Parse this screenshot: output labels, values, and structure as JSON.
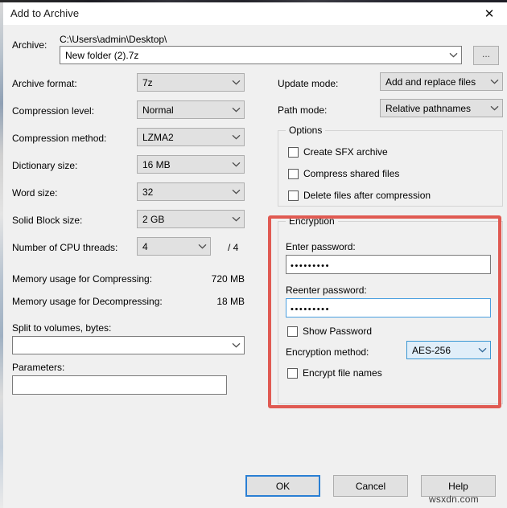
{
  "window": {
    "title": "Add to Archive",
    "close_icon": "close-icon"
  },
  "archive": {
    "label": "Archive:",
    "path": "C:\\Users\\admin\\Desktop\\",
    "value": "New folder (2).7z",
    "browse_label": "..."
  },
  "left_fields": [
    {
      "label": "Archive format:",
      "value": "7z"
    },
    {
      "label": "Compression level:",
      "value": "Normal"
    },
    {
      "label": "Compression method:",
      "value": "LZMA2"
    },
    {
      "label": "Dictionary size:",
      "value": "16 MB"
    },
    {
      "label": "Word size:",
      "value": "32"
    },
    {
      "label": "Solid Block size:",
      "value": "2 GB"
    },
    {
      "label": "Number of CPU threads:",
      "value": "4",
      "suffix": "/ 4"
    }
  ],
  "memory": {
    "compress_label": "Memory usage for Compressing:",
    "compress_value": "720 MB",
    "decompress_label": "Memory usage for Decompressing:",
    "decompress_value": "18 MB"
  },
  "split": {
    "label": "Split to volumes, bytes:",
    "value": ""
  },
  "parameters": {
    "label": "Parameters:",
    "value": ""
  },
  "right_fields": [
    {
      "label": "Update mode:",
      "value": "Add and replace files"
    },
    {
      "label": "Path mode:",
      "value": "Relative pathnames"
    }
  ],
  "options": {
    "title": "Options",
    "items": [
      {
        "label": "Create SFX archive",
        "checked": false
      },
      {
        "label": "Compress shared files",
        "checked": false
      },
      {
        "label": "Delete files after compression",
        "checked": false
      }
    ]
  },
  "encryption": {
    "title": "Encryption",
    "enter_password_label": "Enter password:",
    "enter_password_value": "•••••••••",
    "reenter_password_label": "Reenter password:",
    "reenter_password_value": "•••••••••",
    "show_password_label": "Show Password",
    "show_password_checked": false,
    "method_label": "Encryption method:",
    "method_value": "AES-256",
    "encrypt_names_label": "Encrypt file names",
    "encrypt_names_checked": false,
    "highlight_color": "#e05a52"
  },
  "buttons": {
    "ok": "OK",
    "cancel": "Cancel",
    "help": "Help"
  },
  "watermark": {
    "text": "wsxdn.com"
  }
}
